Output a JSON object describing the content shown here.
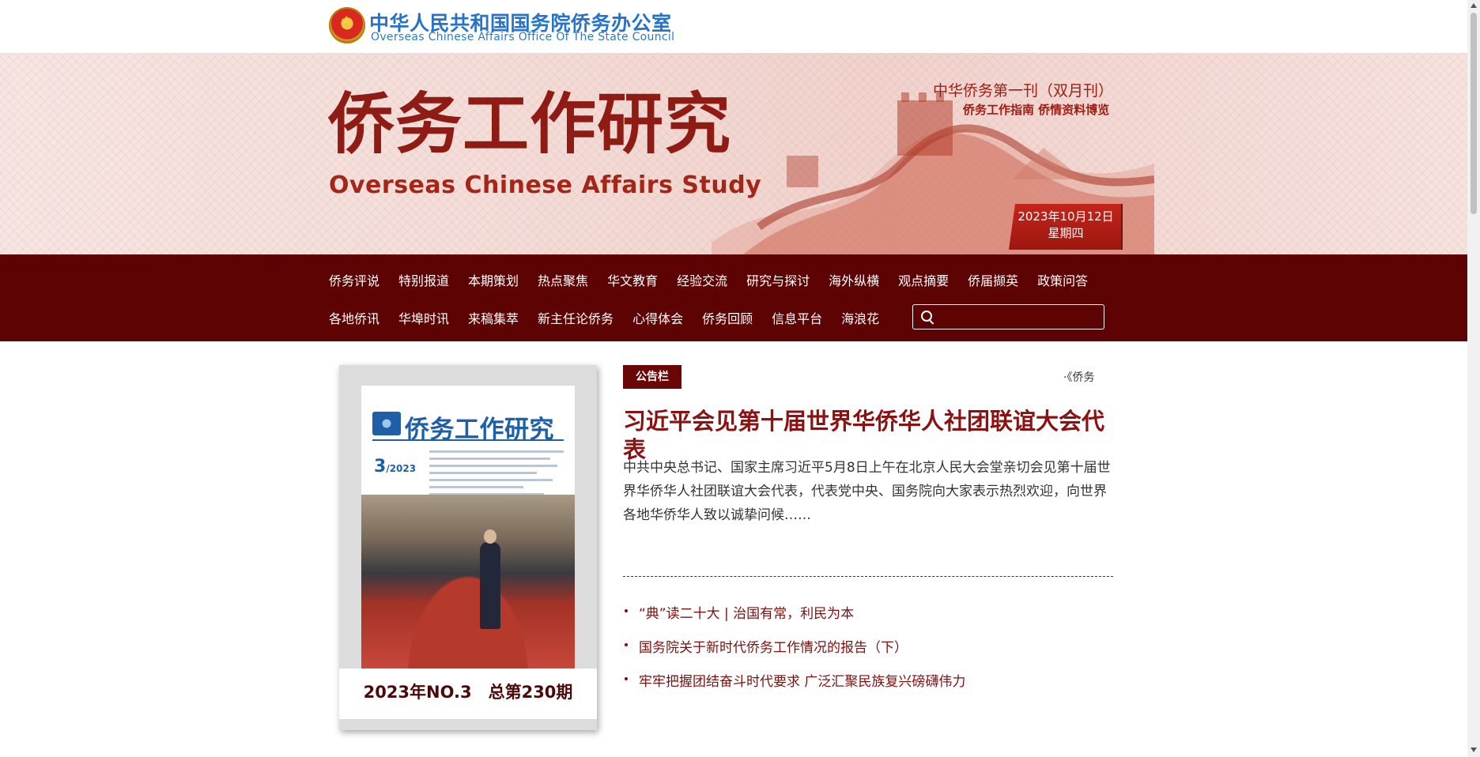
{
  "header": {
    "org_cn": "中华人民共和国国务院侨务办公室",
    "org_en": "Overseas Chinese Affairs Office Of The State Council"
  },
  "banner": {
    "title_cn": "侨务工作研究",
    "title_en": "Overseas Chinese Affairs Study",
    "slogan_line1": "中华侨务第一刊（双月刊）",
    "slogan_line2": "侨务工作指南 侨情资料博览",
    "date": "2023年10月12日",
    "weekday": "星期四"
  },
  "nav": {
    "row1": [
      "侨务评说",
      "特别报道",
      "本期策划",
      "热点聚焦",
      "华文教育",
      "经验交流",
      "研究与探讨",
      "海外纵横",
      "观点摘要",
      "侨届撷英",
      "政策问答"
    ],
    "row2": [
      "各地侨讯",
      "华埠时讯",
      "来稿集萃",
      "新主任论侨务",
      "心得体会",
      "侨务回顾",
      "信息平台",
      "海浪花"
    ],
    "search_placeholder": ""
  },
  "cover": {
    "magazine_title": "侨务工作研究",
    "issue_number": "3",
    "issue_year": "2023",
    "caption": "2023年NO.3　总第230期"
  },
  "notice": {
    "tag": "公告栏",
    "marquee_text": "·《侨务",
    "headline": "习近平会见第十届世界华侨华人社团联谊大会代表",
    "summary": "中共中央总书记、国家主席习近平5月8日上午在北京人民大会堂亲切会见第十届世界华侨华人社团联谊大会代表，代表党中央、国务院向大家表示热烈欢迎，向世界各地华侨华人致以诚挚问候……"
  },
  "news": [
    "“典”读二十大 | 治国有常，利民为本",
    "国务院关于新时代侨务工作情况的报告（下）",
    "牢牢把握团结奋斗时代要求 广泛汇聚民族复兴磅礴伟力"
  ],
  "colors": {
    "nav_bg": "#5e0303",
    "brand_red": "#8e1b14",
    "link_blue": "#2773c9"
  }
}
